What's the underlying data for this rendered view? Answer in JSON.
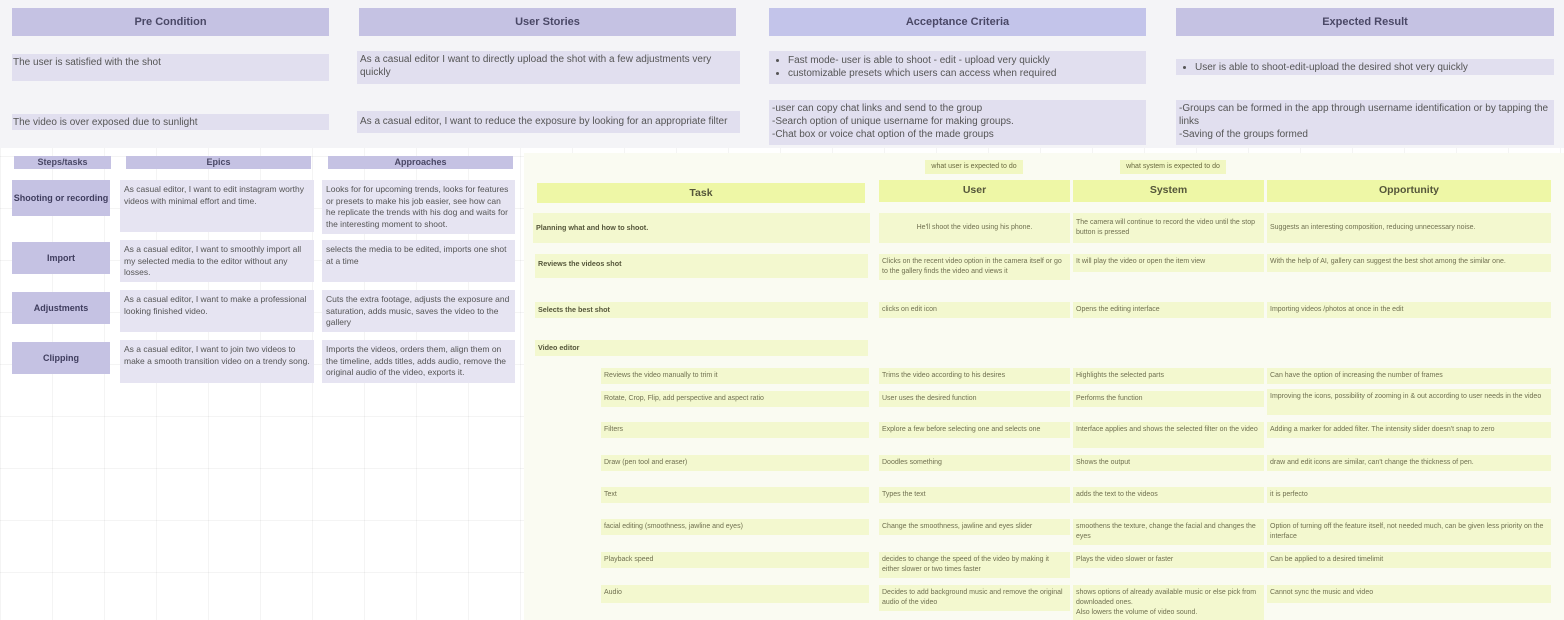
{
  "top_table": {
    "headers": [
      "Pre Condition",
      "User Stories",
      "Acceptance Criteria",
      "Expected Result"
    ],
    "rows": [
      {
        "precondition": "The user is satisfied with the shot",
        "story": "As a casual editor I want to directly upload the shot with a few adjustments very quickly",
        "criteria": [
          "Fast mode- user is able to shoot - edit - upload very quickly",
          "customizable presets which users can access when required"
        ],
        "result": "User is able to shoot-edit-upload the desired shot very quickly"
      },
      {
        "precondition": "The video is over exposed due to sunlight",
        "story": "As a casual editor, I want to reduce the exposure by looking for an appropriate filter",
        "criteria": [
          "-user can copy chat links and send to the group",
          "-Search option of unique username for making groups.",
          "-Chat box or voice chat option of the made groups"
        ],
        "result": [
          "-Groups can be formed in the app through username identification or by tapping the links",
          "-Saving of the groups formed"
        ]
      }
    ]
  },
  "left_table": {
    "headers": [
      "Steps/tasks",
      "Epics",
      "Approaches"
    ],
    "rows": [
      {
        "step": "Shooting or recording",
        "epic": "As casual editor, I want to edit instagram worthy videos with minimal effort and time.",
        "approach": "Looks for for upcoming trends, looks for features or presets to make his job easier, see how can he replicate the trends with his dog and waits for the interesting moment to shoot."
      },
      {
        "step": "Import",
        "epic": "As a casual editor, I want to smoothly import all my selected media to the editor without any losses.",
        "approach": "selects the media to be edited, imports one shot  at a time"
      },
      {
        "step": "Adjustments",
        "epic": "As a casual editor, I want to make a professional looking finished video.",
        "approach": "Cuts the extra footage, adjusts the exposure and saturation, adds music, saves the video to the gallery"
      },
      {
        "step": "Clipping",
        "epic": "As a casual editor, I want to join two videos to make a smooth transition video on a trendy song.",
        "approach": "Imports the videos, orders them, align them on the timeline, adds titles, adds audio, remove the original audio of the video, exports it."
      }
    ]
  },
  "journey": {
    "tags": {
      "user": "what user is expected to do",
      "system": "what system is expected to do"
    },
    "headers": [
      "Task",
      "User",
      "System",
      "Opportunity"
    ],
    "rows": [
      {
        "task": "Planning what and how to shoot.",
        "user": "He'll shoot the video using his phone.",
        "system": "The camera will continue to record the video until the stop button is pressed",
        "opportunity": "Suggests an interesting composition, reducing unnecessary noise."
      },
      {
        "task": "Reviews the videos shot",
        "user": "Clicks on the recent video option in the camera itself or go to the gallery finds the video and views it",
        "system": "It will play the video or open the item view",
        "opportunity": "With the help of AI, gallery can suggest the best shot among the similar one."
      },
      {
        "task": "Selects the best shot",
        "user": "clicks on edit icon",
        "system": "Opens the editing interface",
        "opportunity": "Importing videos /photos at once in the edit"
      },
      {
        "task": "Video editor",
        "user": "",
        "system": "",
        "opportunity": ""
      }
    ],
    "subrows": [
      {
        "task": "Reviews the video manually to trim it",
        "user": "Trims the video according to his desires",
        "system": "Highlights the selected parts",
        "opportunity": "Can have the option of increasing the number of frames"
      },
      {
        "task": "Rotate, Crop, Flip, add perspective and aspect ratio",
        "user": "User uses the desired function",
        "system": "Performs the function",
        "opportunity": "Improving the icons, possibility of zooming in & out according to user needs in the video"
      },
      {
        "task": "Filters",
        "user": "Explore a few before selecting one and selects one",
        "system": "Interface applies and shows the selected filter on the video",
        "opportunity": "Adding a marker for added filter. The intensity slider doesn't snap to zero"
      },
      {
        "task": "Draw (pen tool and eraser)",
        "user": "Doodles something",
        "system": "Shows the output",
        "opportunity": "draw and edit icons are similar, can't change the thickness of pen."
      },
      {
        "task": "Text",
        "user": "Types the text",
        "system": "adds the text to the videos",
        "opportunity": "it is perfecto"
      },
      {
        "task": "facial editing (smoothness, jawline and eyes)",
        "user": "Change the smoothness, jawline and eyes slider",
        "system": "smoothens the texture, change the facial and changes the eyes",
        "opportunity": "Option of turning off the feature itself, not needed much, can be given less priority on the interface"
      },
      {
        "task": "Playback speed",
        "user": "decides to change the speed of the video by making it either slower or two times faster",
        "system": "Plays the video slower or faster",
        "opportunity": "Can be applied to a desired timelimit"
      },
      {
        "task": "Audio",
        "user": "Decides to add background music and remove the original audio of the video",
        "system": "shows options of already available music or else pick from downloaded ones.",
        "system2": "Also lowers the volume of video sound.",
        "opportunity": "Cannot sync the music and video"
      }
    ]
  }
}
